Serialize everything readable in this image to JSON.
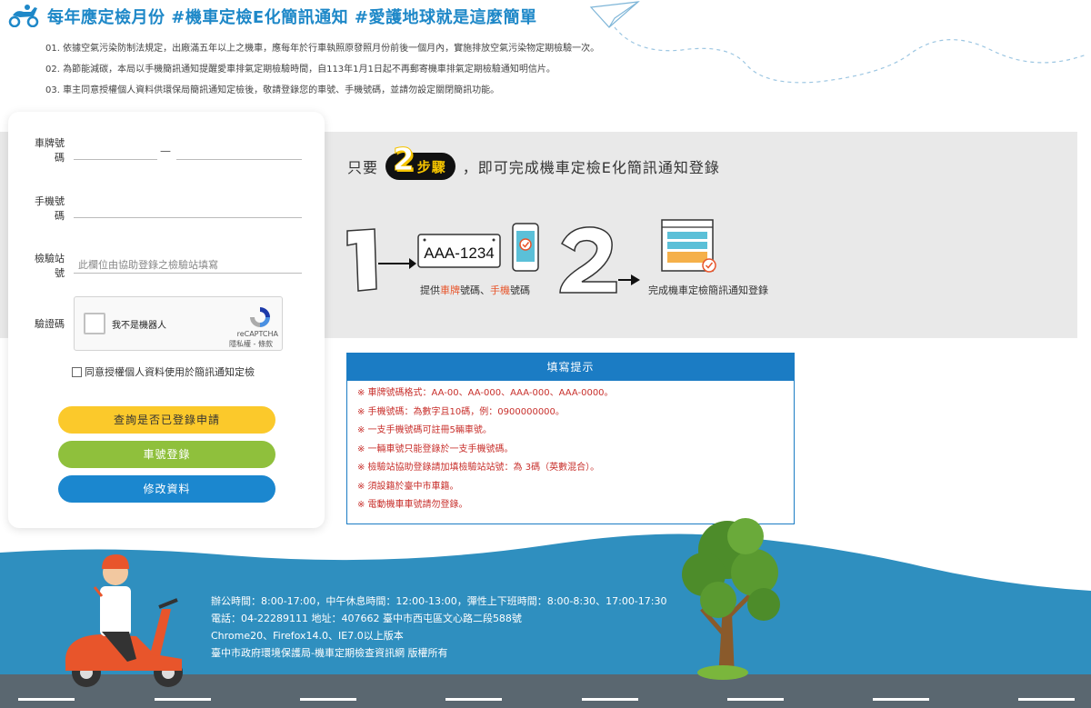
{
  "header": {
    "title": "每年應定檢月份 #機車定檢E化簡訊通知 #愛護地球就是這麼簡單",
    "notes": [
      "01. 依據空氣污染防制法規定，出廠滿五年以上之機車，應每年於行車執照原發照月份前後一個月內，實施排放空氣污染物定期檢驗一次。",
      "02. 為節能減碳，本局以手機簡訊通知提醒愛車排氣定期檢驗時間，自113年1月1日起不再郵寄機車排氣定期檢驗通知明信片。",
      "03. 車主同意授權個人資料供環保局簡訊通知定檢後，敬請登錄您的車號、手機號碼，並請勿設定關閉簡訊功能。"
    ]
  },
  "form": {
    "plate_label": "車牌號碼",
    "plate_dash": "—",
    "phone_label": "手機號碼",
    "station_label": "檢驗站號",
    "station_placeholder": "此欄位由協助登錄之檢驗站填寫",
    "captcha_label": "驗證碼",
    "captcha_text": "我不是機器人",
    "captcha_brand": "reCAPTCHA",
    "captcha_links": "隱私權 - 條款",
    "agree_label": "同意授權個人資料使用於簡訊通知定檢",
    "btn_query": "查詢是否已登錄申請",
    "btn_register": "車號登錄",
    "btn_modify": "修改資料"
  },
  "steps": {
    "prefix": "只要",
    "num": "2",
    "word": "步驟",
    "suffix": "，即可完成機車定檢E化簡訊通知登錄",
    "plate_sample": "AAA-1234",
    "step1_a": "提供",
    "step1_b": "車牌",
    "step1_c": "號碼、",
    "step1_d": "手機",
    "step1_e": "號碼",
    "step2_caption": "完成機車定檢簡訊通知登錄"
  },
  "tips": {
    "title": "填寫提示",
    "items": [
      "※ 車牌號碼格式：AA-00、AA-000、AAA-000、AAA-0000。",
      "※ 手機號碼：為數字且10碼，例：0900000000。",
      "※ 一支手機號碼可註冊5輛車號。",
      "※ 一輛車號只能登錄於一支手機號碼。",
      "※ 檢驗站協助登錄請加填檢驗站站號：為 3碼（英數混合）。",
      "※ 須設籍於臺中市車籍。",
      "※ 電動機車車號請勿登錄。"
    ]
  },
  "footer": {
    "hours": "辦公時間：8:00-17:00，中午休息時間：12:00-13:00，彈性上下班時間：8:00-8:30、17:00-17:30",
    "contact": "電話：04-22289111 地址：407662 臺中市西屯區文心路二段588號",
    "browser": "Chrome20、Firefox14.0、IE7.0以上版本",
    "copyright": "臺中市政府環境保護局-機車定期檢查資訊網 版權所有"
  },
  "colors": {
    "brand_blue": "#1e88c8",
    "sea_blue": "#2f8fbf",
    "road": "#5a6770",
    "button_yellow": "#fbc92b",
    "button_green": "#8fc03c",
    "button_blue": "#1b87cf",
    "tip_red": "#c8302c"
  }
}
